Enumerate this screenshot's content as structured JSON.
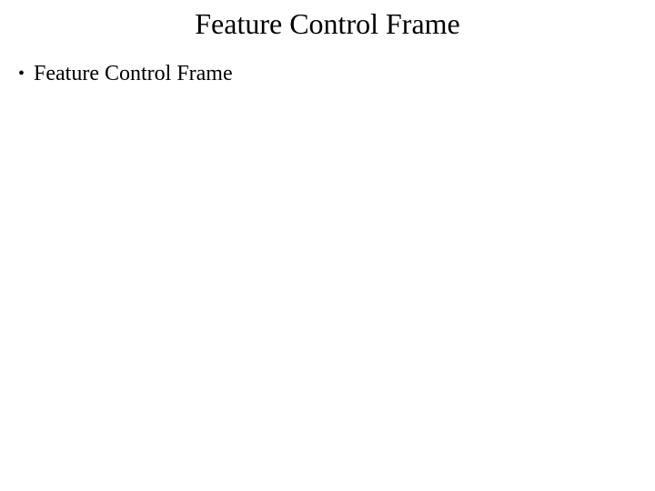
{
  "title": "Feature Control Frame",
  "bullets": [
    {
      "text": "Feature Control Frame"
    }
  ]
}
